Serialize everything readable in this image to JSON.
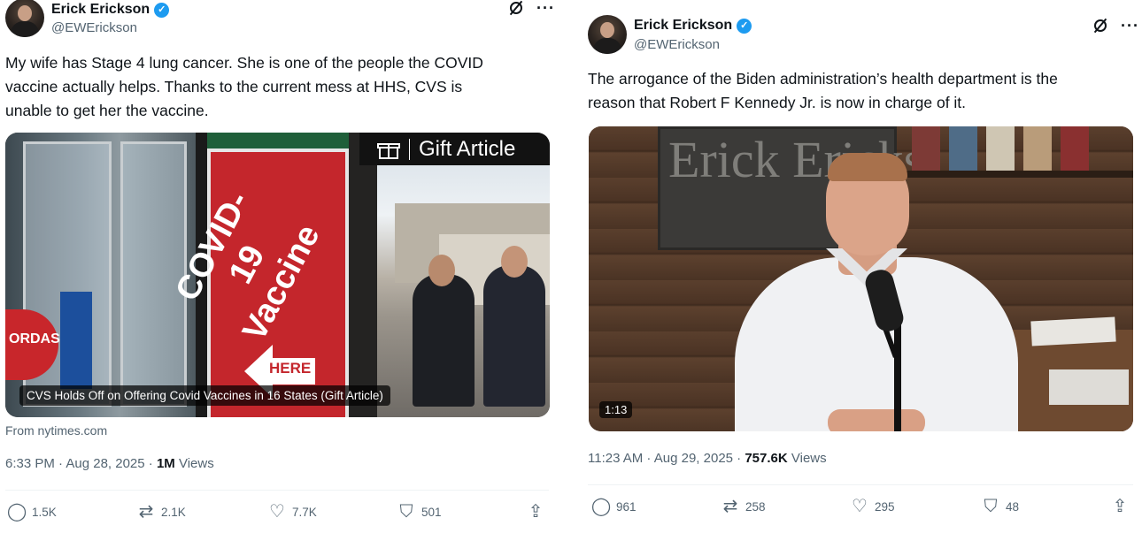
{
  "left_tweet": {
    "author": {
      "name": "Erick Erickson",
      "handle": "@EWErickson"
    },
    "text_lines": [
      "My wife has Stage 4 lung cancer.  She is one of the people the COVID",
      "vaccine actually helps.  Thanks to the current mess at HHS, CVS is",
      "unable to get her the vaccine."
    ],
    "media": {
      "gift_label": "Gift Article",
      "caption": "CVS Holds Off on Offering Covid Vaccines in 16 States (Gift Article)",
      "banner_text": "COVID-19 Vaccine",
      "banner_here": "HERE",
      "storefront_text": "ORDASH"
    },
    "from": "From nytimes.com",
    "meta": {
      "time_date": "6:33 PM · Aug 28, 2025 · ",
      "views_count": "1M",
      "views_label": " Views"
    },
    "stats": {
      "replies": "1.5K",
      "reposts": "2.1K",
      "likes": "7.7K",
      "bookmarks": "501"
    }
  },
  "right_tweet": {
    "author": {
      "name": "Erick Erickson",
      "handle": "@EWErickson"
    },
    "text_lines": [
      "The arrogance of the Biden administration’s health department is the",
      "reason that Robert F Kennedy Jr. is now in charge of it."
    ],
    "media": {
      "duration": "1:13",
      "sign_text": "Erick Ericks"
    },
    "meta": {
      "time_date": "11:23 AM · Aug 29, 2025 · ",
      "views_count": "757.6K",
      "views_label": " Views"
    },
    "stats": {
      "replies": "961",
      "reposts": "258",
      "likes": "295",
      "bookmarks": "48"
    }
  },
  "icons": {
    "verified": "verified-badge-icon",
    "grok": "grok-icon",
    "more": "more-icon",
    "reply": "reply-icon",
    "repost": "repost-icon",
    "like": "like-icon",
    "bookmark": "bookmark-icon",
    "share": "share-icon"
  },
  "colors": {
    "verified": "#1d9bf0",
    "secondary_text": "#536471",
    "gift_bar": "#121212",
    "banner_red": "#c4262c"
  }
}
